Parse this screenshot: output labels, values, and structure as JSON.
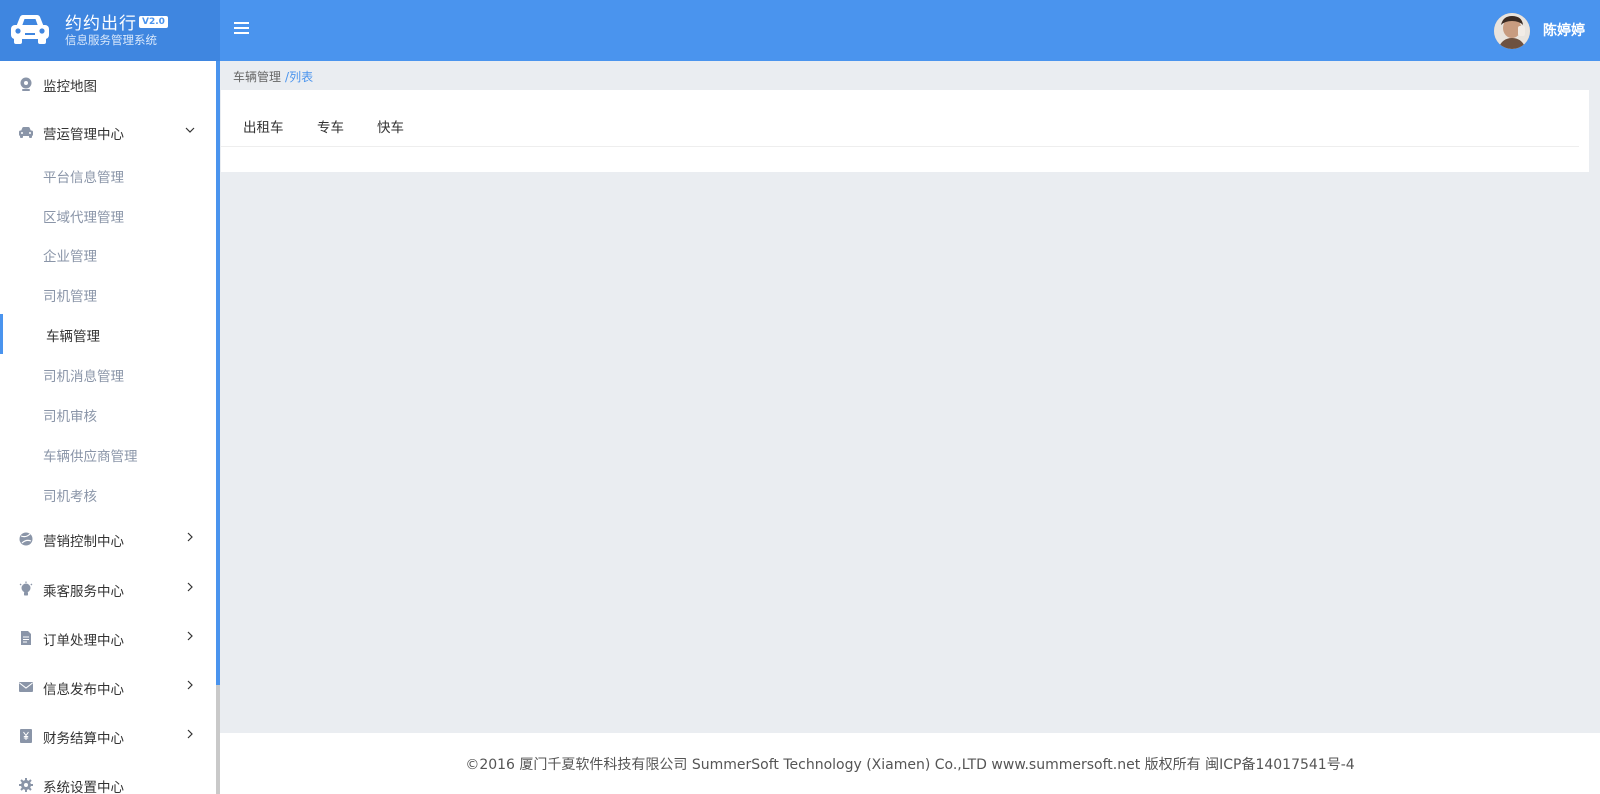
{
  "brand": {
    "title": "约约出行",
    "version": "V2.0",
    "subtitle": "信息服务管理系统"
  },
  "header": {
    "username": "陈婷婷",
    "menu_icon": "hamburger-icon",
    "accent_color": "#4a94ee"
  },
  "sidebar": {
    "sections": [
      {
        "label": "监控地图",
        "icon": "map-pin-icon"
      },
      {
        "label": "营运管理中心",
        "icon": "car-icon",
        "expanded": true
      },
      {
        "label": "营销控制中心",
        "icon": "globe-icon"
      },
      {
        "label": "乘客服务中心",
        "icon": "lightbulb-icon"
      },
      {
        "label": "订单处理中心",
        "icon": "document-icon"
      },
      {
        "label": "信息发布中心",
        "icon": "mail-icon"
      },
      {
        "label": "财务结算中心",
        "icon": "yen-icon"
      },
      {
        "label": "系统设置中心",
        "icon": "gear-icon"
      }
    ],
    "sub_items": [
      "平台信息管理",
      "区域代理管理",
      "企业管理",
      "司机管理",
      "车辆管理",
      "司机消息管理",
      "司机审核",
      "车辆供应商管理",
      "司机考核"
    ],
    "active_sub": "车辆管理"
  },
  "breadcrumb": {
    "parent": "车辆管理",
    "separator": "/",
    "current": "列表"
  },
  "tabs": [
    "出租车",
    "专车",
    "快车"
  ],
  "footer": {
    "text": "©2016 厦门千夏软件科技有限公司 SummerSoft Technology (Xiamen) Co.,LTD www.summersoft.net 版权所有 闽ICP备14017541号-4"
  }
}
